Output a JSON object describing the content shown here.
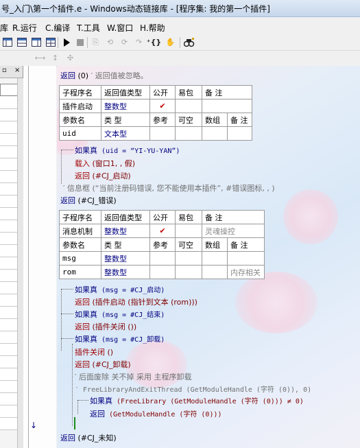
{
  "window": {
    "title": "号_入门\\第一个插件.e - Windows动态链接库 - [程序集: 我的第一个插件]"
  },
  "menu": [
    "库",
    "R.运行",
    "C.编译",
    "T.工具",
    "W.窗口",
    "H.帮助"
  ],
  "toolbar": {
    "row1_icons": [
      "layout-icon",
      "layout2-icon",
      "layout3-icon",
      "layout4-icon",
      "run-icon",
      "stop-icon",
      "step-icon",
      "step-into-icon",
      "step-out-icon",
      "step-over-icon",
      "braces-icon",
      "hand-icon",
      "find-icon"
    ],
    "row2_icons": [
      "resize-h-icon",
      "resize-v-icon",
      "grid-icon"
    ]
  },
  "leftpanel": {
    "close_glyph": "×",
    "pin_glyph": "▫"
  },
  "code": {
    "line1": {
      "kw": "返回",
      "args": " (0)",
      "comment": "  ′ 返回值被忽略。"
    },
    "table1": {
      "headers": [
        "子程序名",
        "返回值类型",
        "公开",
        "易包",
        "备 注"
      ],
      "row": [
        "插件启动",
        "整数型",
        "✔",
        "",
        ""
      ],
      "param_headers": [
        "参数名",
        "类 型",
        "参考",
        "可空",
        "数组",
        "备 注"
      ],
      "params": [
        [
          "uid",
          "文本型",
          "",
          "",
          "",
          ""
        ]
      ]
    },
    "if1": {
      "kw": "如果真",
      "cond": " (uid = “YI-YU-YAN”)"
    },
    "load": {
      "kw": "载入",
      "args": " (窗口1, , 假)"
    },
    "ret_start": {
      "kw": "返回",
      "args": " (#CJ_启动)"
    },
    "msgbox_comment": "′ 信息框 (“当前注册码错误, 您不能使用本插件”, #错误图标, , )",
    "ret_err": {
      "kw": "返回",
      "args": " (#CJ_错误)"
    },
    "table2": {
      "headers": [
        "子程序名",
        "返回值类型",
        "公开",
        "易包",
        "备 注"
      ],
      "row": [
        "消息机制",
        "整数型",
        "✔",
        "",
        "灵魂操控"
      ],
      "param_headers": [
        "参数名",
        "类 型",
        "参考",
        "可空",
        "数组",
        "备 注"
      ],
      "params": [
        [
          "msg",
          "整数型",
          "",
          "",
          "",
          ""
        ],
        [
          "rom",
          "整数型",
          "",
          "",
          "",
          "内存相关"
        ]
      ]
    },
    "if2": {
      "kw": "如果真",
      "cond": " (msg = #CJ_启动)"
    },
    "ret2": {
      "kw": "返回",
      "args": " (插件启动 (指针到文本 (rom)))"
    },
    "if3": {
      "kw": "如果真",
      "cond": " (msg = #CJ_结束)"
    },
    "ret3": {
      "kw": "返回",
      "args": " (插件关闭 ())"
    },
    "if4": {
      "kw": "如果真",
      "cond": " (msg = #CJ_卸载)"
    },
    "close_plugin": {
      "kw": "插件关闭",
      "args": " ()"
    },
    "ret4": {
      "kw": "返回",
      "args": " (#CJ_卸载)"
    },
    "comment2": "′ 后面废除 关不掉 采用 主程序卸载",
    "comment3": "′ FreeLibraryAndExitThread (GetModuleHandle (字符 (0)), 0)",
    "if5": {
      "kw": "如果真",
      "cond": " (FreeLibrary (GetModuleHandle (字符 (0))) ≠ 0)"
    },
    "ret5": {
      "kw": "返回",
      "args": " (GetModuleHandle (字符 (0)))"
    },
    "ret_unknown": {
      "kw": "返回",
      "args": " (#CJ_未知)"
    }
  },
  "colors": {
    "keyword": "#000080",
    "flow": "#a00000",
    "comment": "#707070"
  }
}
